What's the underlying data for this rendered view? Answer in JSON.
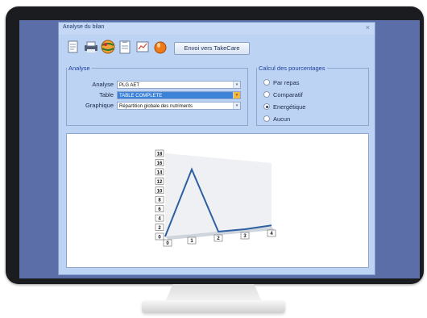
{
  "window": {
    "title": "Analyse du bilan",
    "close_glyph": "×"
  },
  "toolbar": {
    "icons": [
      "notes-icon",
      "printer-icon",
      "globe-icon",
      "clipboard-icon",
      "chart-icon",
      "food-icon"
    ],
    "send_label": "Envoi vers TakeCare"
  },
  "analyse": {
    "legend": "Analyse",
    "analyse_label": "Analyse",
    "analyse_value": "PLG AET",
    "table_label": "Table",
    "table_value": "TABLE COMPLETE",
    "graph_label": "Graphique",
    "graph_value": "Répartition globale des nutriments"
  },
  "calc": {
    "legend": "Calcul des pourcentages",
    "options": [
      {
        "label": "Par repas",
        "checked": false
      },
      {
        "label": "Comparatif",
        "checked": false
      },
      {
        "label": "Energétique",
        "checked": true
      },
      {
        "label": "Aucun",
        "checked": false
      }
    ]
  },
  "chart_data": {
    "type": "line",
    "x": [
      "0",
      "1",
      "2",
      "3",
      "4"
    ],
    "series": [
      {
        "values": [
          0,
          14,
          0,
          0,
          0.3
        ]
      }
    ],
    "yticks": [
      "0",
      "2",
      "4",
      "6",
      "8",
      "10",
      "12",
      "14",
      "16",
      "18"
    ],
    "ylim": [
      0,
      18
    ],
    "line_color": "#2e5fa0"
  }
}
